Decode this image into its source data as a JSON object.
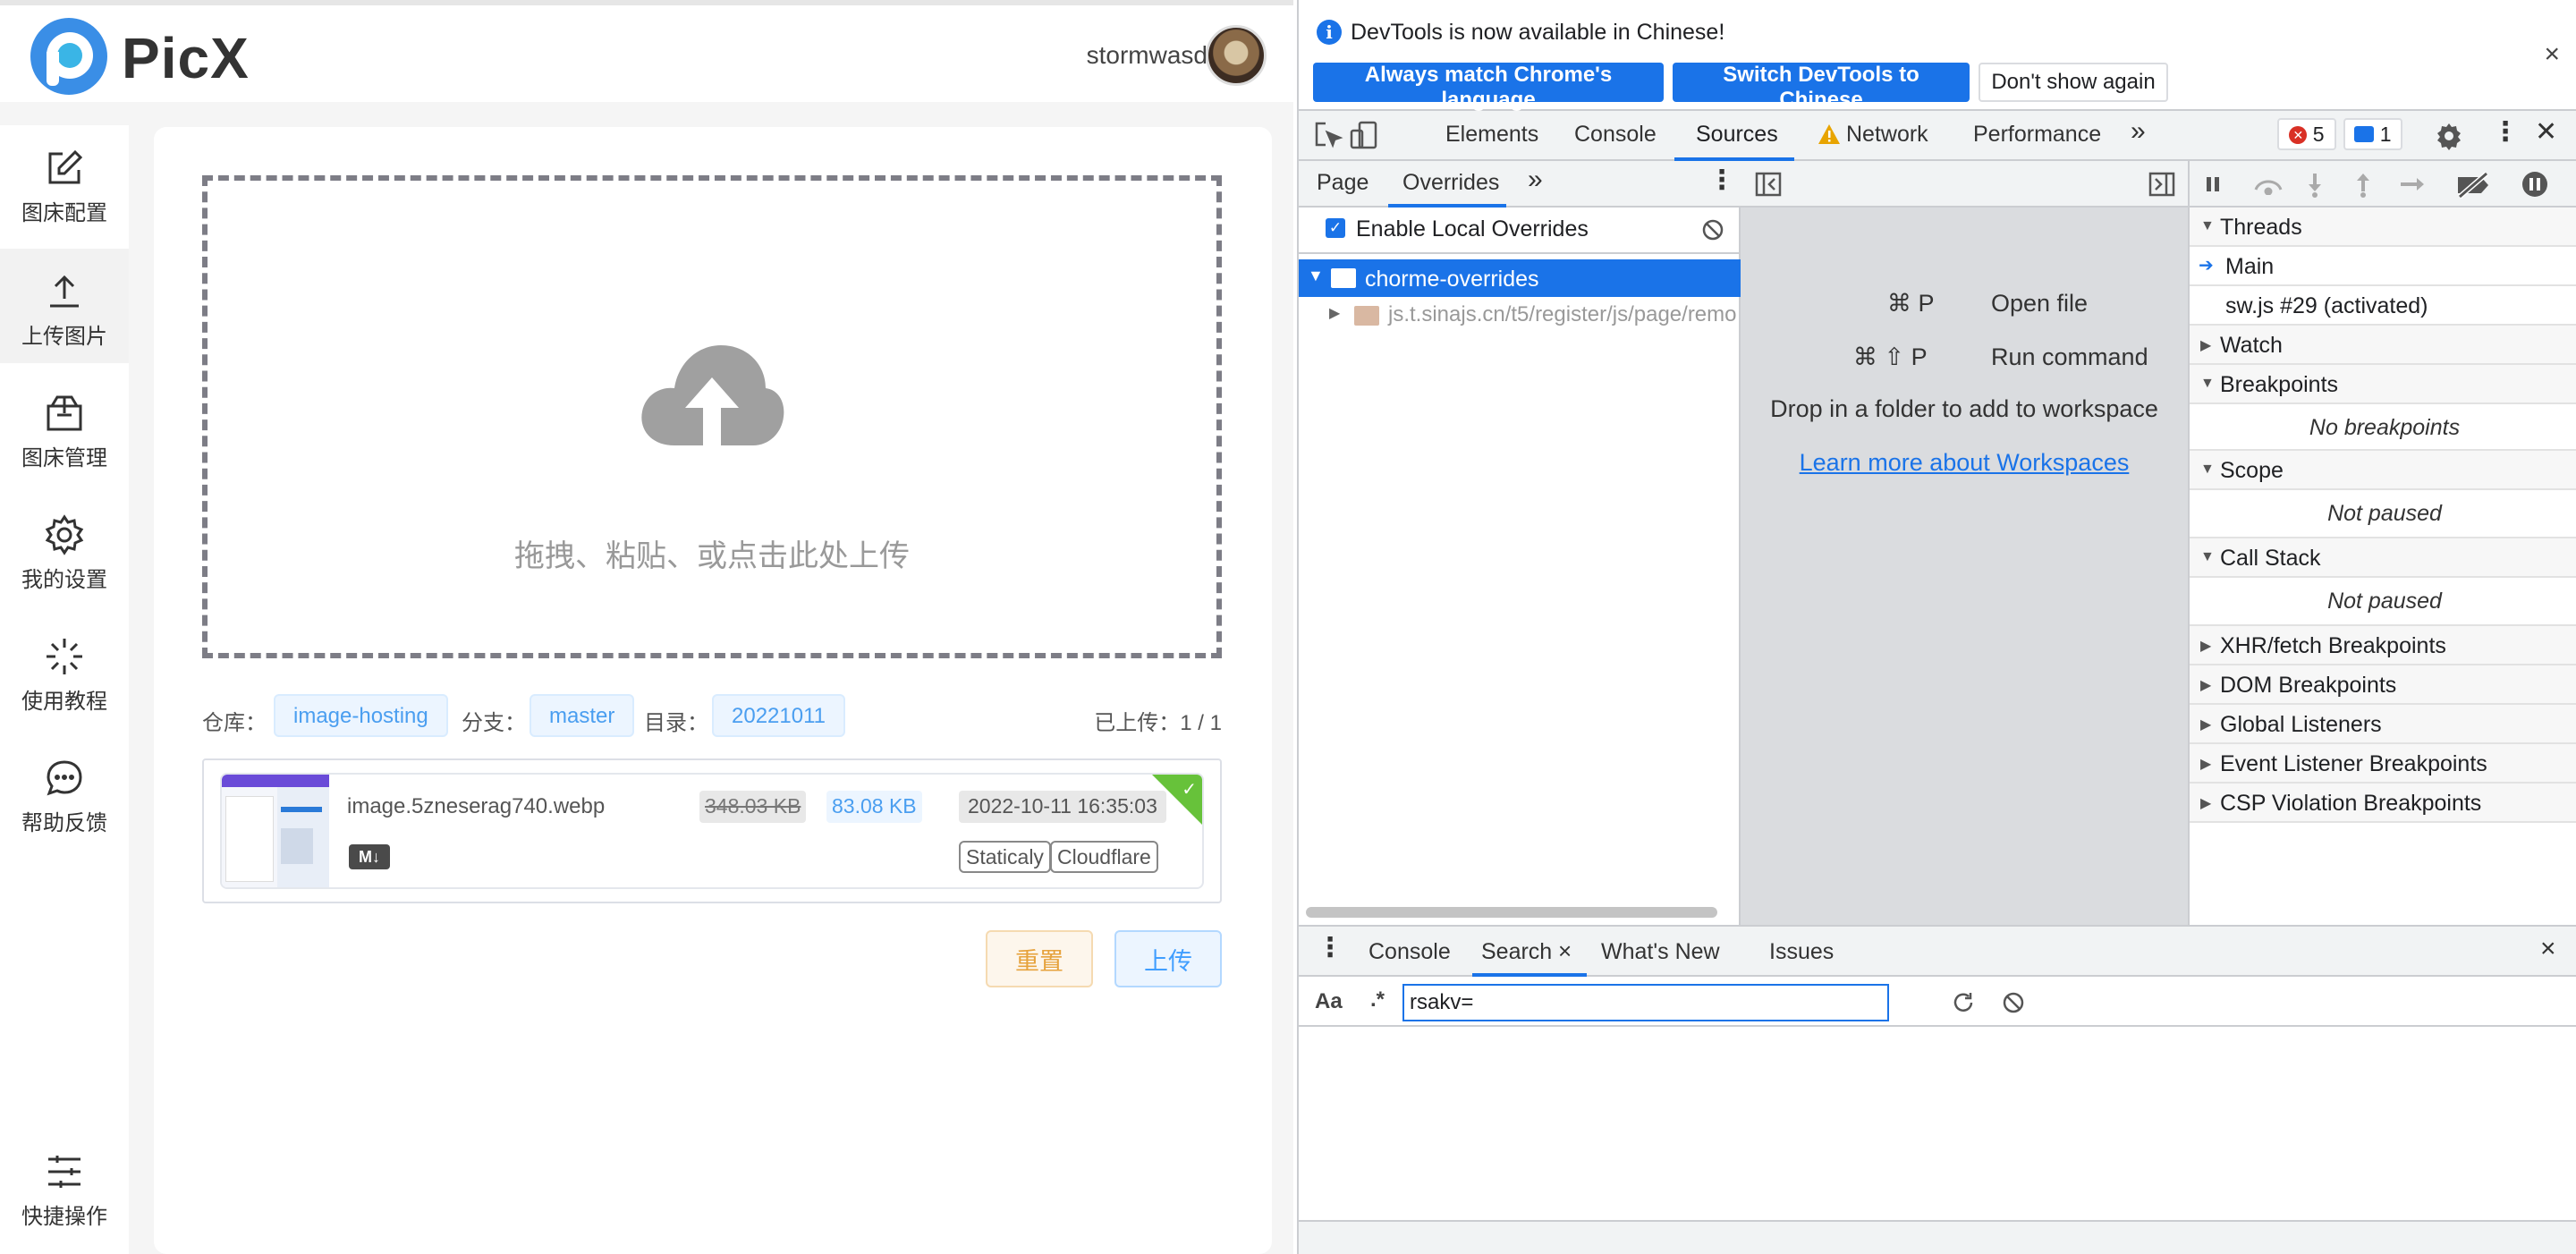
{
  "picx": {
    "logo_text": "PicX",
    "username": "stormwasd",
    "sidebar": {
      "items": [
        {
          "label": "图床配置",
          "icon": "edit-icon"
        },
        {
          "label": "上传图片",
          "icon": "upload-icon",
          "active": true
        },
        {
          "label": "图床管理",
          "icon": "package-icon"
        },
        {
          "label": "我的设置",
          "icon": "gear-icon"
        },
        {
          "label": "使用教程",
          "icon": "sparkle-icon"
        },
        {
          "label": "帮助反馈",
          "icon": "chat-icon"
        }
      ],
      "bottom_item": {
        "label": "快捷操作",
        "icon": "sliders-icon"
      }
    },
    "dropzone_hint": "拖拽、粘贴、或点击此处上传",
    "repo": {
      "repo_label": "仓库：",
      "repo_value": "image-hosting",
      "branch_label": "分支：",
      "branch_value": "master",
      "dir_label": "目录：",
      "dir_value": "20221011",
      "uploaded_count": "已上传：1 / 1"
    },
    "file": {
      "name": "image.5zneserag740.webp",
      "original_size": "348.03 KB",
      "compressed_size": "83.08 KB",
      "upload_time": "2022-10-11 16:35:03",
      "md_label": "M↓",
      "cdn_tags": [
        "Staticaly",
        "Cloudflare"
      ],
      "status_check": "✓"
    },
    "buttons": {
      "reset": "重置",
      "upload": "上传"
    },
    "colors": {
      "accent": "#409eff",
      "success": "#67c23a",
      "warning": "#e6a23c"
    }
  },
  "devtools": {
    "infobar": {
      "message": "DevTools is now available in Chinese!",
      "info_glyph": "i",
      "btn_match": "Always match Chrome's language",
      "btn_switch": "Switch DevTools to Chinese",
      "btn_dont": "Don't show again",
      "close": "×"
    },
    "tabs": [
      {
        "label": "Elements"
      },
      {
        "label": "Console"
      },
      {
        "label": "Sources",
        "active": true
      },
      {
        "label": "Network",
        "warning": true
      },
      {
        "label": "Performance"
      }
    ],
    "more_tabs": "»",
    "error_count": "5",
    "message_count": "1",
    "navigator": {
      "tabs": [
        "Page",
        "Overrides"
      ],
      "more": "»",
      "enable_local_overrides": "Enable Local Overrides",
      "enable_checked": true,
      "tree_root": "chorme-overrides",
      "tree_child": "js.t.sinajs.cn/t5/register/js/page/remo"
    },
    "editor": {
      "shortcuts": [
        {
          "keys": "⌘ P",
          "action": "Open file"
        },
        {
          "keys": "⌘ ⇧ P",
          "action": "Run command"
        }
      ],
      "drop_hint": "Drop in a folder to add to workspace",
      "learn_more": "Learn more about Workspaces"
    },
    "debugger": {
      "threads": "Threads",
      "thread_main": "Main",
      "thread_sw": "sw.js #29 (activated)",
      "watch": "Watch",
      "breakpoints": "Breakpoints",
      "no_breakpoints": "No breakpoints",
      "scope": "Scope",
      "scope_status": "Not paused",
      "call_stack": "Call Stack",
      "call_stack_status": "Not paused",
      "xhr": "XHR/fetch Breakpoints",
      "dom": "DOM Breakpoints",
      "global": "Global Listeners",
      "event": "Event Listener Breakpoints",
      "csp": "CSP Violation Breakpoints"
    },
    "drawer": {
      "tabs": [
        "Console",
        "Search",
        "What's New",
        "Issues"
      ],
      "active_tab": "Search",
      "tab_close": "×",
      "case_toggle": "Aa",
      "regex_toggle": ".*",
      "search_value": "rsakv=",
      "close": "×"
    }
  }
}
